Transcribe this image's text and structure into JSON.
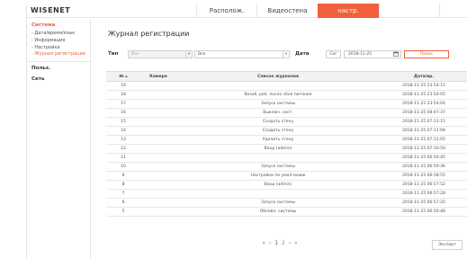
{
  "brand": {
    "logo_text": "WISENET"
  },
  "top_nav": {
    "tabs": [
      {
        "label": ""
      },
      {
        "label": "Располож."
      },
      {
        "label": "Видеостена"
      },
      {
        "label": "настр."
      }
    ],
    "active_color": "#f0603d"
  },
  "sidebar": {
    "system": {
      "heading": "Система",
      "items": [
        {
          "label": "- Дата/время/язык"
        },
        {
          "label": "- Информация"
        },
        {
          "label": "- Настройки"
        },
        {
          "label": "- Журнал регистрации"
        }
      ]
    },
    "users": {
      "heading": "Польз."
    },
    "network": {
      "heading": "Сеть"
    }
  },
  "page": {
    "title": "Журнал регистрации"
  },
  "filters": {
    "type_label": "Тип",
    "type_select1": "Все",
    "type_select2": "Все",
    "date_label": "Дата",
    "today_button": "Сег",
    "date_value": "2018-11-25",
    "search_button": "Поиск"
  },
  "table": {
    "headers": [
      "№ ▴",
      "Камера",
      "Список журналов",
      "Дата/вр."
    ],
    "rows": [
      {
        "no": "19",
        "camera": "",
        "log": "",
        "date": "2018-11-25 23:54:15"
      },
      {
        "no": "18",
        "camera": "",
        "log": "Возоб. раб. после сбоя питания",
        "date": "2018-11-25 23:54:05"
      },
      {
        "no": "17",
        "camera": "",
        "log": "Запуск системы",
        "date": "2018-11-25 23:54:04"
      },
      {
        "no": "16",
        "camera": "",
        "log": "Выключ. сист.",
        "date": "2018-11-25 08:47:37"
      },
      {
        "no": "15",
        "camera": "",
        "log": "Создать стену",
        "date": "2018-11-25 07:11:15"
      },
      {
        "no": "14",
        "camera": "",
        "log": "Создать стену",
        "date": "2018-11-25 07:11:08"
      },
      {
        "no": "13",
        "camera": "",
        "log": "Удалить стену",
        "date": "2018-11-25 07:11:05"
      },
      {
        "no": "12",
        "camera": "",
        "log": "Вход (admin)",
        "date": "2018-11-25 07:10:50"
      },
      {
        "no": "11",
        "camera": "",
        "log": "",
        "date": "2018-11-25 06:59:45"
      },
      {
        "no": "10",
        "camera": "",
        "log": "Запуск системы",
        "date": "2018-11-25 06:59:36"
      },
      {
        "no": "9",
        "camera": "",
        "log": "Настройки по умолчанию",
        "date": "2018-11-25 06:58:55"
      },
      {
        "no": "8",
        "camera": "",
        "log": "Вход (admin)",
        "date": "2018-11-25 06:57:52"
      },
      {
        "no": "7",
        "camera": "",
        "log": "",
        "date": "2018-11-25 06:57:28"
      },
      {
        "no": "6",
        "camera": "",
        "log": "Запуск системы",
        "date": "2018-11-25 06:57:20"
      },
      {
        "no": "5",
        "camera": "",
        "log": "Обновл. системы",
        "date": "2018-11-25 06:56:48"
      }
    ]
  },
  "pager": {
    "first": "«",
    "prev": "‹",
    "pages": [
      "1",
      "2"
    ],
    "next": "›",
    "last": "»"
  },
  "export_button": "Экспорт"
}
